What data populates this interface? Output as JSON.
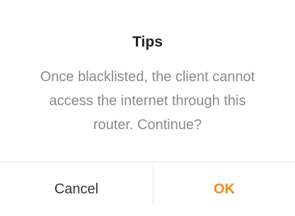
{
  "dialog": {
    "title": "Tips",
    "message_lines": [
      "Once blacklisted, the client cannot",
      "access the internet through this",
      "router. Continue?"
    ],
    "cancel_label": "Cancel",
    "ok_label": "OK"
  },
  "colors": {
    "accent": "#f28a1c",
    "message_text": "#8a8a8a",
    "title_text": "#222222",
    "divider": "#e6e6e6"
  }
}
